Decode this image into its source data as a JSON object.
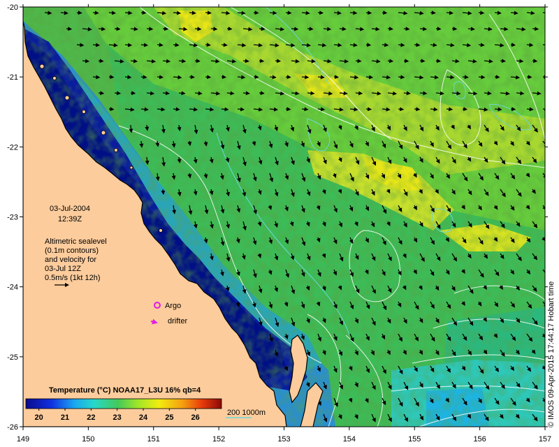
{
  "map": {
    "lon_range": [
      149,
      157
    ],
    "lat_range": [
      -26,
      -20
    ],
    "x_ticks": [
      "149",
      "150",
      "151",
      "152",
      "153",
      "154",
      "155",
      "156",
      "157"
    ],
    "y_ticks": [
      "-20",
      "-21",
      "-22",
      "-23",
      "-24",
      "-25",
      "-26"
    ]
  },
  "date": "03-Jul-2004",
  "time": "12:39Z",
  "notes": [
    "Altimetric sealevel",
    "(0.1m contours)",
    "and velocity for",
    "03-Jul 12Z",
    "0.5m/s (1kt 12h)"
  ],
  "markers": {
    "argo": "Argo",
    "drifter": "drifter"
  },
  "colorbar": {
    "title": "Temperature (°C) NOAA17_L3U 16% qb=4",
    "ticks": [
      "20",
      "21",
      "22",
      "23",
      "24",
      "25",
      "26"
    ],
    "range": [
      19.5,
      27
    ]
  },
  "bathymetry_label": "200  1000m",
  "credit": "© IMOS 09-Apr-2015 17:44:17 Hobart time",
  "colors": {
    "land": "#fccc9c",
    "cold": "#000f85",
    "mid": "#36c463",
    "warm": "#e6f20f",
    "contour": "#ffffff",
    "isobath": "#6ad7d8",
    "marker": "#e41be4"
  }
}
